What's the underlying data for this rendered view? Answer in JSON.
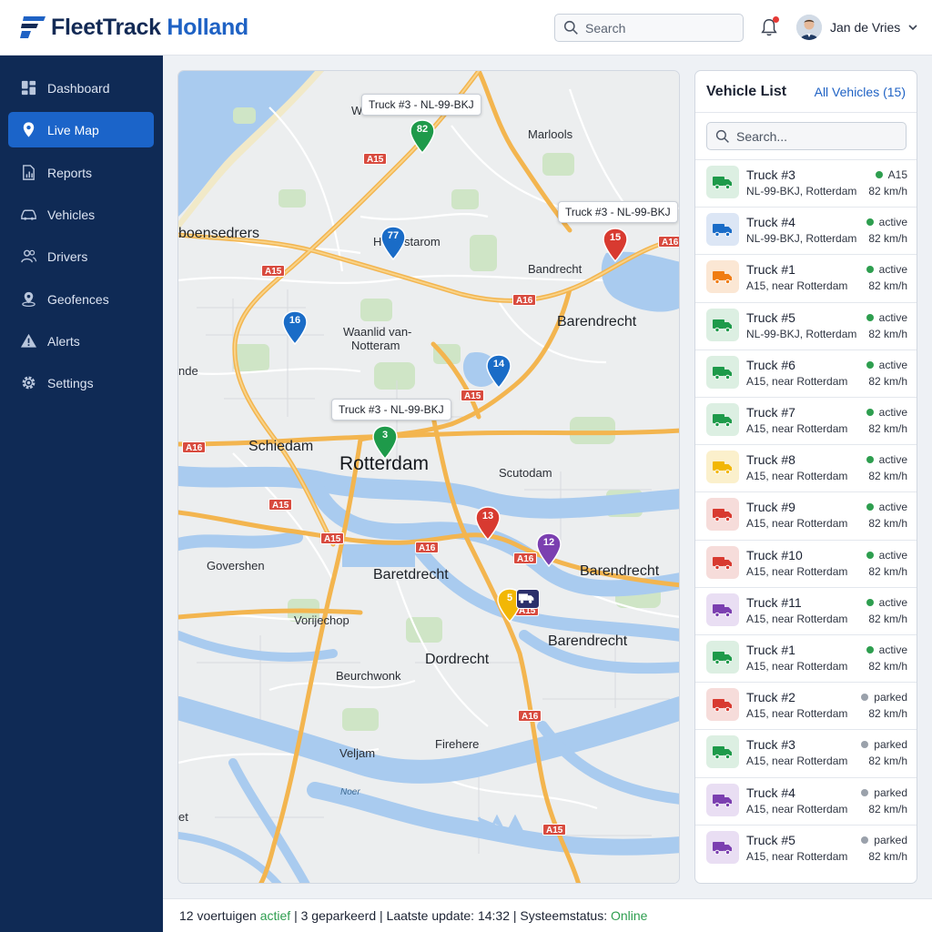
{
  "app": {
    "name_part1": "FleetTrack",
    "name_part2": "Holland"
  },
  "header": {
    "search_placeholder": "Search",
    "user_name": "Jan de Vries",
    "notification_dot_color": "#e53935"
  },
  "sidebar": {
    "items": [
      {
        "label": "Dashboard",
        "icon": "dashboard-icon"
      },
      {
        "label": "Live Map",
        "icon": "map-pin-icon",
        "active": true
      },
      {
        "label": "Reports",
        "icon": "reports-icon"
      },
      {
        "label": "Vehicles",
        "icon": "car-icon"
      },
      {
        "label": "Drivers",
        "icon": "users-icon"
      },
      {
        "label": "Geofences",
        "icon": "geofence-icon"
      },
      {
        "label": "Alerts",
        "icon": "alert-icon"
      },
      {
        "label": "Settings",
        "icon": "gear-icon"
      }
    ]
  },
  "map": {
    "callouts": [
      "Truck #3 - NL-99-BKJ",
      "Truck #3 - NL-99-BKJ",
      "Truck #3 - NL-99-BKJ"
    ],
    "labels": {
      "wa": "Wa",
      "marlools": "Marlools",
      "boensedrers": "boensedrers",
      "hstarom": "H",
      "hstarom2": "starom",
      "bandrecht": "Bandrecht",
      "barendrecht_n": "Barendrecht",
      "waanlid": "Waanlid van-",
      "notteram": "Notteram",
      "nde": "nde",
      "schiedam": "Schiedam",
      "rotterdam": "Rotterdam",
      "scutodam": "Scutodam",
      "govershen": "Govershen",
      "baretdrecht": "Baretdrecht",
      "barendrecht_e": "Barendrecht",
      "vorijechop": "Vorijechop",
      "dordrecht": "Dordrecht",
      "barendrecht_s": "Barendrecht",
      "beurchwonk": "Beurchwonk",
      "firehere": "Firehere",
      "veljam": "Veljam",
      "noer": "Noer",
      "et": "et"
    },
    "shields": {
      "s1": "A15",
      "s2": "A16",
      "s3": "A15",
      "s4": "A16",
      "s5": "A15",
      "s6": "A16",
      "s7": "A15",
      "s8": "A15",
      "s9": "A16",
      "s10": "A16",
      "s11": "A16",
      "s12": "A15",
      "s13": "A15"
    },
    "pins": [
      {
        "label": "82",
        "color": "#1e9a4a"
      },
      {
        "label": "77",
        "color": "#1a6cc7"
      },
      {
        "label": "15",
        "color": "#d83a30"
      },
      {
        "label": "16",
        "color": "#1a6cc7"
      },
      {
        "label": "14",
        "color": "#1a6cc7"
      },
      {
        "label": "3",
        "color": "#1e9a4a"
      },
      {
        "label": "13",
        "color": "#d83a30"
      },
      {
        "label": "12",
        "color": "#7b3fb0"
      },
      {
        "label": "5",
        "color": "#f2b705"
      }
    ]
  },
  "vehicle_list": {
    "title": "Vehicle List",
    "all_link": "All Vehicles (15)",
    "search_placeholder": "Search...",
    "vehicles": [
      {
        "name": "Truck #3",
        "location": "NL-99-BKJ, Rotterdam",
        "status": "A15",
        "speed": "82 km/h",
        "color": "#1e9a4a",
        "bg": "#dcefe2",
        "status_color": "#2e9e4f"
      },
      {
        "name": "Truck #4",
        "location": "NL-99-BKJ, Rotterdam",
        "status": "active",
        "speed": "82 km/h",
        "color": "#1a6cc7",
        "bg": "#dce6f5",
        "status_color": "#2e9e4f"
      },
      {
        "name": "Truck #1",
        "location": "A15, near Rotterdam",
        "status": "active",
        "speed": "82 km/h",
        "color": "#f07c12",
        "bg": "#fbe7d4",
        "status_color": "#2e9e4f"
      },
      {
        "name": "Truck #5",
        "location": "NL-99-BKJ, Rotterdam",
        "status": "active",
        "speed": "82 km/h",
        "color": "#1e9a4a",
        "bg": "#dcefe2",
        "status_color": "#2e9e4f"
      },
      {
        "name": "Truck #6",
        "location": "A15, near Rotterdam",
        "status": "active",
        "speed": "82 km/h",
        "color": "#1e9a4a",
        "bg": "#dcefe2",
        "status_color": "#2e9e4f"
      },
      {
        "name": "Truck #7",
        "location": "A15, near Rotterdam",
        "status": "active",
        "speed": "82 km/h",
        "color": "#1e9a4a",
        "bg": "#dcefe2",
        "status_color": "#2e9e4f"
      },
      {
        "name": "Truck #8",
        "location": "A15, near Rotterdam",
        "status": "active",
        "speed": "82 km/h",
        "color": "#f2b705",
        "bg": "#fbf0cc",
        "status_color": "#2e9e4f"
      },
      {
        "name": "Truck #9",
        "location": "A15, near Rotterdam",
        "status": "active",
        "speed": "82 km/h",
        "color": "#d83a30",
        "bg": "#f6dcda",
        "status_color": "#2e9e4f"
      },
      {
        "name": "Truck #10",
        "location": "A15, near Rotterdam",
        "status": "active",
        "speed": "82 km/h",
        "color": "#d83a30",
        "bg": "#f6dcda",
        "status_color": "#2e9e4f"
      },
      {
        "name": "Truck #11",
        "location": "A15, near Rotterdam",
        "status": "active",
        "speed": "82 km/h",
        "color": "#7b3fb0",
        "bg": "#e9def3",
        "status_color": "#2e9e4f"
      },
      {
        "name": "Truck #1",
        "location": "A15, near Rotterdam",
        "status": "active",
        "speed": "82 km/h",
        "color": "#1e9a4a",
        "bg": "#dcefe2",
        "status_color": "#2e9e4f"
      },
      {
        "name": "Truck #2",
        "location": "A15, near Rotterdam",
        "status": "parked",
        "speed": "82 km/h",
        "color": "#d83a30",
        "bg": "#f6dcda",
        "status_color": "#9aa1ab"
      },
      {
        "name": "Truck #3",
        "location": "A15, near Rotterdam",
        "status": "parked",
        "speed": "82 km/h",
        "color": "#1e9a4a",
        "bg": "#dcefe2",
        "status_color": "#9aa1ab"
      },
      {
        "name": "Truck #4",
        "location": "A15, near Rotterdam",
        "status": "parked",
        "speed": "82 km/h",
        "color": "#7b3fb0",
        "bg": "#e9def3",
        "status_color": "#9aa1ab"
      },
      {
        "name": "Truck #5",
        "location": "A15, near Rotterdam",
        "status": "parked",
        "speed": "82 km/h",
        "color": "#7b3fb0",
        "bg": "#e9def3",
        "status_color": "#9aa1ab"
      }
    ]
  },
  "footer": {
    "part1": "12 voertuigen ",
    "actief": "actief",
    "part2": " | 3 geparkeerd | Laatste update: 14:32 | Systeemstatus: ",
    "online": "Online"
  }
}
